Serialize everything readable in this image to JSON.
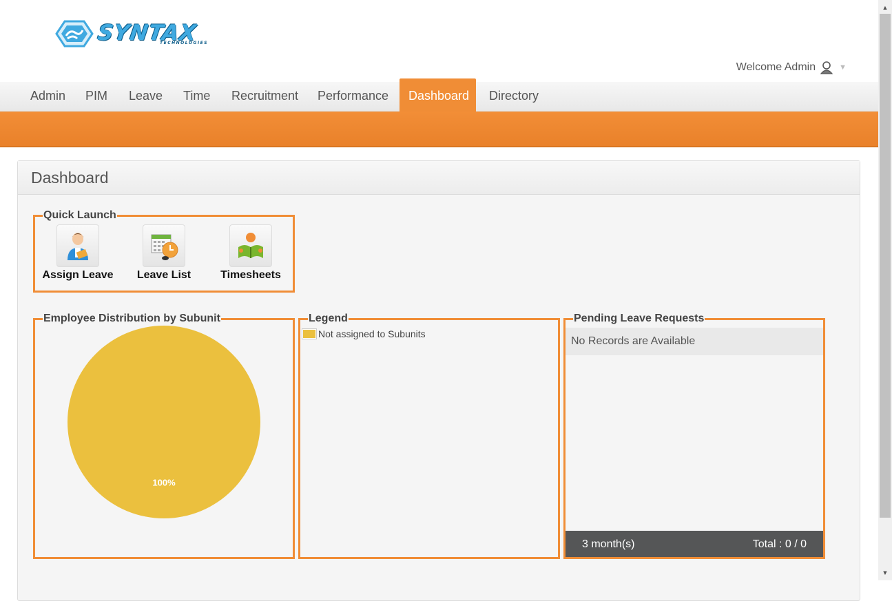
{
  "header": {
    "logo_text": "SYNTAX",
    "logo_subtext": "TECHNOLOGIES",
    "welcome": "Welcome Admin"
  },
  "menu": {
    "items": [
      "Admin",
      "PIM",
      "Leave",
      "Time",
      "Recruitment",
      "Performance",
      "Dashboard",
      "Directory"
    ],
    "active": "Dashboard"
  },
  "dashboard": {
    "title": "Dashboard",
    "quick_launch": {
      "title": "Quick Launch",
      "items": [
        {
          "label": "Assign Leave",
          "icon": "assign-leave-icon"
        },
        {
          "label": "Leave List",
          "icon": "leave-list-icon"
        },
        {
          "label": "Timesheets",
          "icon": "timesheets-icon"
        }
      ]
    },
    "distribution": {
      "title": "Employee Distribution by Subunit"
    },
    "legend": {
      "title": "Legend",
      "items": [
        "Not assigned to Subunits"
      ]
    },
    "pending": {
      "title": "Pending Leave Requests",
      "no_records": "No Records are Available",
      "period": "3 month(s)",
      "total": "Total : 0 / 0"
    }
  },
  "chart_data": {
    "type": "pie",
    "slices": [
      {
        "label": "Not assigned to Subunits",
        "value": 100,
        "display": "100%",
        "color": "#ebc03e"
      }
    ],
    "title": "Employee Distribution by Subunit"
  },
  "colors": {
    "accent": "#f08d36",
    "pie": "#ebc03e",
    "footer": "#555657"
  }
}
